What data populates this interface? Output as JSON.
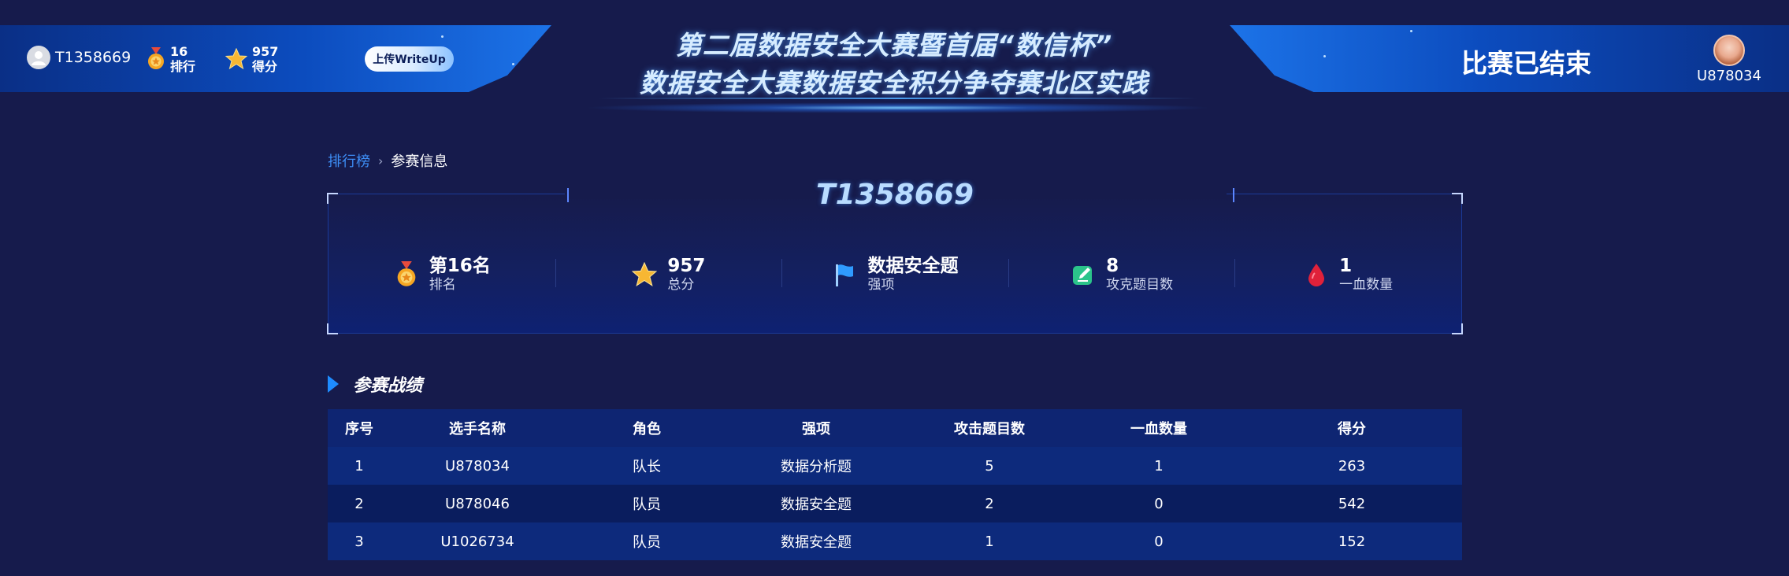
{
  "header": {
    "team_name": "T1358669",
    "rank_value": "16",
    "rank_label": "排行",
    "score_value": "957",
    "score_label": "得分",
    "upload_label": "上传WriteUp",
    "title_line1": "第二届数据安全大赛暨首届“数信杯”",
    "title_line2": "数据安全大赛数据安全积分争夺赛北区实践",
    "status": "比赛已结束",
    "user_name": "U878034"
  },
  "breadcrumb": {
    "parent": "排行榜",
    "separator": "›",
    "current": "参赛信息"
  },
  "team_card": {
    "title": "T1358669",
    "stats": [
      {
        "icon": "medal-icon",
        "value": "第16名",
        "label": "排名"
      },
      {
        "icon": "star-icon",
        "value": "957",
        "label": "总分"
      },
      {
        "icon": "flag-icon",
        "value": "数据安全题",
        "label": "强项"
      },
      {
        "icon": "edit-icon",
        "value": "8",
        "label": "攻克题目数"
      },
      {
        "icon": "blood-drop-icon",
        "value": "1",
        "label": "一血数量"
      }
    ]
  },
  "section": {
    "title": "参赛战绩"
  },
  "table": {
    "columns": [
      "序号",
      "选手名称",
      "角色",
      "强项",
      "攻击题目数",
      "一血数量",
      "得分"
    ],
    "rows": [
      [
        "1",
        "U878034",
        "队长",
        "数据分析题",
        "5",
        "1",
        "263"
      ],
      [
        "2",
        "U878046",
        "队员",
        "数据安全题",
        "2",
        "0",
        "542"
      ],
      [
        "3",
        "U1026734",
        "队员",
        "数据安全题",
        "1",
        "0",
        "152"
      ]
    ]
  },
  "colors": {
    "background": "#161b4c",
    "accent_blue": "#1e8cff",
    "link": "#3d8df5"
  }
}
